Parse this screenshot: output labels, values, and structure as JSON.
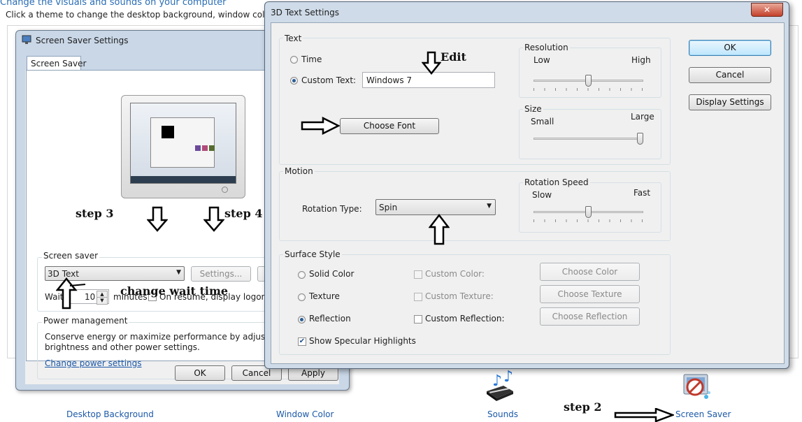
{
  "background": {
    "header_text": "Change the visuals and sounds on your computer",
    "description": "Click a theme to change the desktop background, window color, sound",
    "bottom_links": [
      "Desktop Background",
      "Window Color",
      "Sounds",
      "Screen Saver"
    ]
  },
  "screen_saver_dialog": {
    "title": "Screen Saver Settings",
    "tab": "Screen Saver",
    "screen_saver_group": "Screen saver",
    "selected_saver": "3D Text",
    "settings_button": "Settings...",
    "wait_label": "Wait:",
    "wait_value": "10",
    "minutes_label": "minutes",
    "resume_label": "On resume, display logon scr",
    "resume_checked": false,
    "power_group": "Power management",
    "power_text_line1": "Conserve energy or maximize performance by adjusting disp",
    "power_text_line2": "brightness and other power settings.",
    "power_link": "Change power settings",
    "ok": "OK",
    "cancel": "Cancel",
    "apply": "Apply"
  },
  "text3d_dialog": {
    "title": "3D Text Settings",
    "close_glyph": "✕",
    "text_group": "Text",
    "time_label": "Time",
    "custom_text_label": "Custom Text:",
    "custom_text_value": "Windows 7",
    "choose_font": "Choose Font",
    "resolution_group": "Resolution",
    "resolution_low": "Low",
    "resolution_high": "High",
    "resolution_value": 0.5,
    "size_group": "Size",
    "size_small": "Small",
    "size_large": "Large",
    "size_value": 1.0,
    "motion_group": "Motion",
    "rotation_type_label": "Rotation Type:",
    "rotation_type_value": "Spin",
    "rotation_speed_group": "Rotation Speed",
    "speed_slow": "Slow",
    "speed_fast": "Fast",
    "speed_value": 0.5,
    "surface_group": "Surface Style",
    "solid_color": "Solid Color",
    "texture": "Texture",
    "reflection": "Reflection",
    "custom_color": "Custom Color:",
    "custom_texture": "Custom Texture:",
    "custom_reflection": "Custom Reflection:",
    "choose_color": "Choose Color",
    "choose_texture": "Choose Texture",
    "choose_reflection": "Choose Reflection",
    "specular": "Show Specular Highlights",
    "ok": "OK",
    "cancel": "Cancel",
    "display_settings": "Display Settings"
  },
  "annotations": {
    "step2": "step 2",
    "step3": "step 3",
    "step4": "step 4",
    "edit": "Edit",
    "change_wait": "change wait time"
  },
  "colors": {
    "link": "#1c59a8",
    "selected_radio": "#2a5d93"
  }
}
